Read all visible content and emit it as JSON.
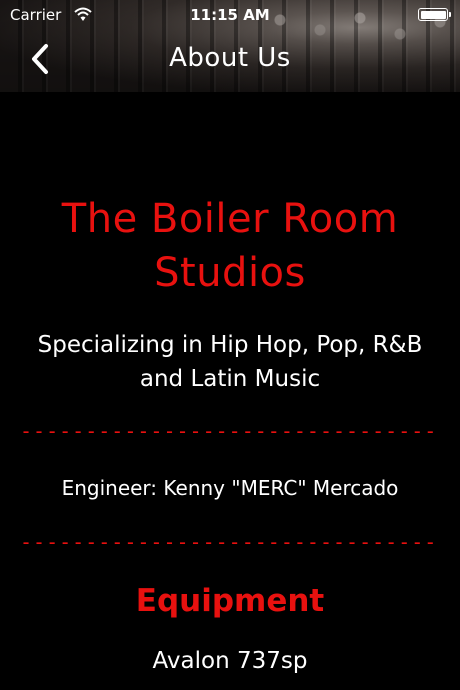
{
  "status_bar": {
    "carrier": "Carrier",
    "time": "11:15 AM"
  },
  "nav": {
    "title": "About Us",
    "back_icon": "chevron-left-icon"
  },
  "about": {
    "studio_name_line1": "The Boiler Room",
    "studio_name_line2": "Studios",
    "specialty_line1": "Specializing in Hip Hop, Pop, R&B",
    "specialty_line2": "and Latin Music",
    "divider": "------------------------------------",
    "engineer": "Engineer: Kenny \"MERC\" Mercado",
    "equipment_heading": "Equipment",
    "equipment": [
      "Avalon 737sp"
    ]
  },
  "colors": {
    "accent": "#e8110f",
    "background": "#000000",
    "text": "#ffffff"
  }
}
